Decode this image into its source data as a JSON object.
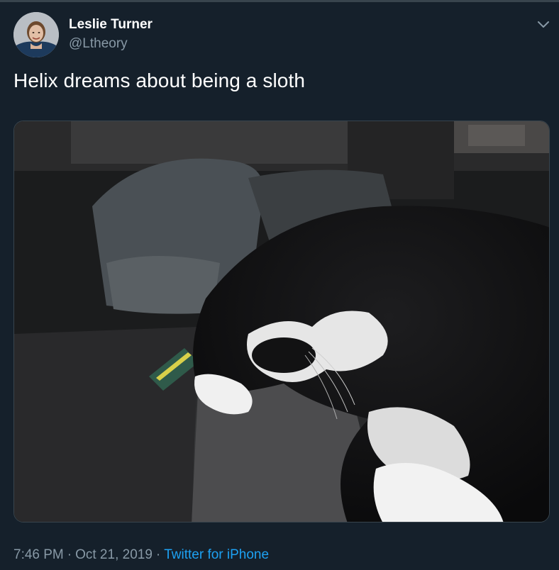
{
  "author": {
    "name": "Leslie Turner",
    "handle": "@Ltheory"
  },
  "tweet": {
    "text": "Helix dreams about being a sloth"
  },
  "meta": {
    "time": "7:46 PM",
    "separator": "·",
    "date": "Oct 21, 2019",
    "source": "Twitter for iPhone"
  },
  "colors": {
    "background": "#15202b",
    "secondary_text": "#8899a6",
    "link": "#1da1f2"
  },
  "icons": {
    "menu": "chevron-down-icon"
  }
}
